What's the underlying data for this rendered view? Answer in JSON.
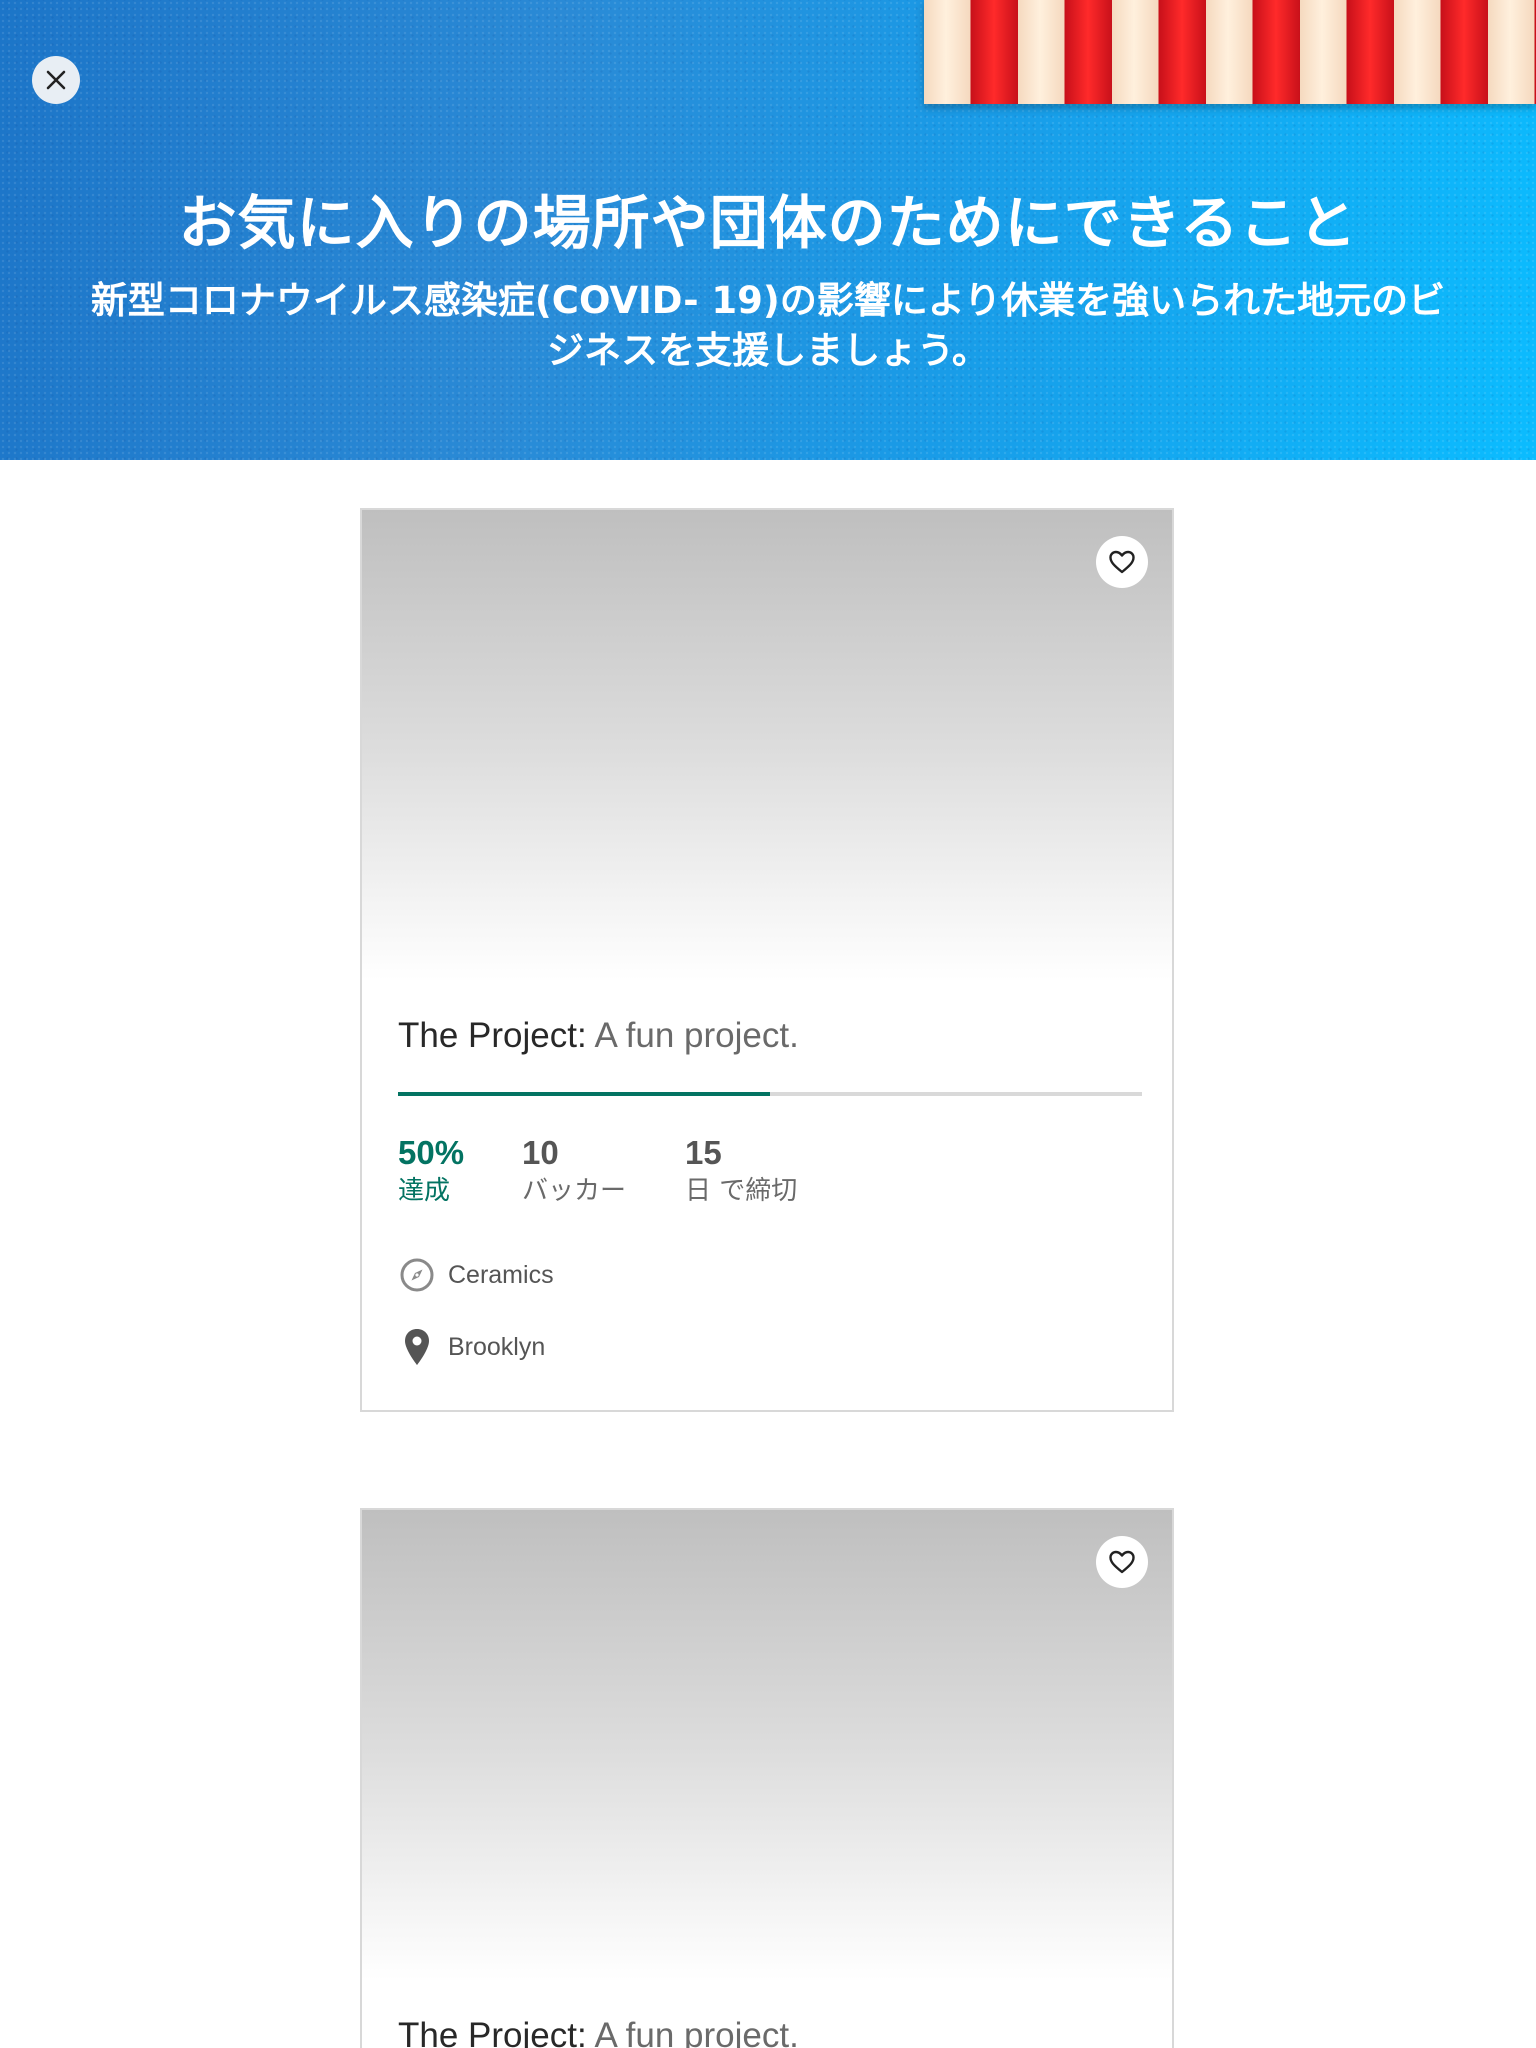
{
  "banner": {
    "title": "お気に入りの場所や団体のためにできること",
    "subtitle": "新型コロナウイルス感染症(COVID- 19)の影響により休業を強いられた地元のビジネスを支援しましょう。"
  },
  "colors": {
    "accent_green": "#037362",
    "banner_blue": "#1a9ae6",
    "awning_red": "#e8141e"
  },
  "cards": [
    {
      "title_name": "The Project:",
      "title_blurb": "A fun project.",
      "progress_fraction": 0.5,
      "pledged_value": "50%",
      "pledged_label": "達成",
      "backers_value": "10",
      "backers_label": "バッカー",
      "days_value": "15",
      "days_label": "日 で締切",
      "category": "Ceramics",
      "location": "Brooklyn",
      "category_icon": "compass-icon",
      "location_icon": "map-pin-icon",
      "favorite_icon": "heart-icon"
    },
    {
      "title_name": "The Project:",
      "title_blurb": "A fun project.",
      "favorite_icon": "heart-icon"
    }
  ]
}
